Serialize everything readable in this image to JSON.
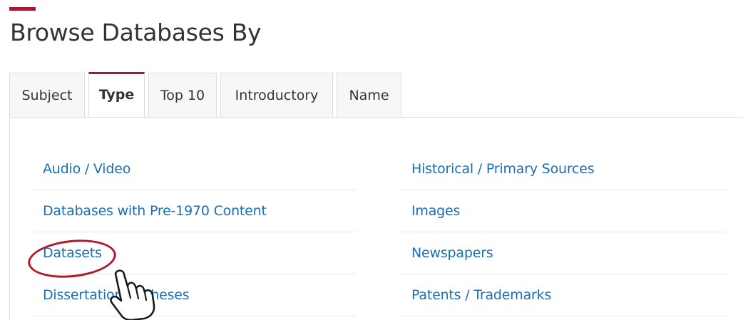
{
  "page": {
    "title": "Browse Databases By",
    "accent_color": "#a6192e",
    "link_color": "#1a6fb5"
  },
  "tabs": [
    {
      "label": "Subject",
      "active": false
    },
    {
      "label": "Type",
      "active": true
    },
    {
      "label": "Top 10",
      "active": false
    },
    {
      "label": "Introductory",
      "active": false
    },
    {
      "label": "Name",
      "active": false
    }
  ],
  "types": {
    "left": [
      {
        "label": "Audio / Video"
      },
      {
        "label": "Databases with Pre-1970 Content"
      },
      {
        "label": "Datasets"
      },
      {
        "label": "Dissertations / Theses"
      }
    ],
    "right": [
      {
        "label": "Historical / Primary Sources"
      },
      {
        "label": "Images"
      },
      {
        "label": "Newspapers"
      },
      {
        "label": "Patents / Trademarks"
      }
    ]
  },
  "annotation": {
    "highlighted_item": "Datasets",
    "highlight_color": "#b0182c",
    "pointer_icon": "hand-pointer-icon"
  }
}
